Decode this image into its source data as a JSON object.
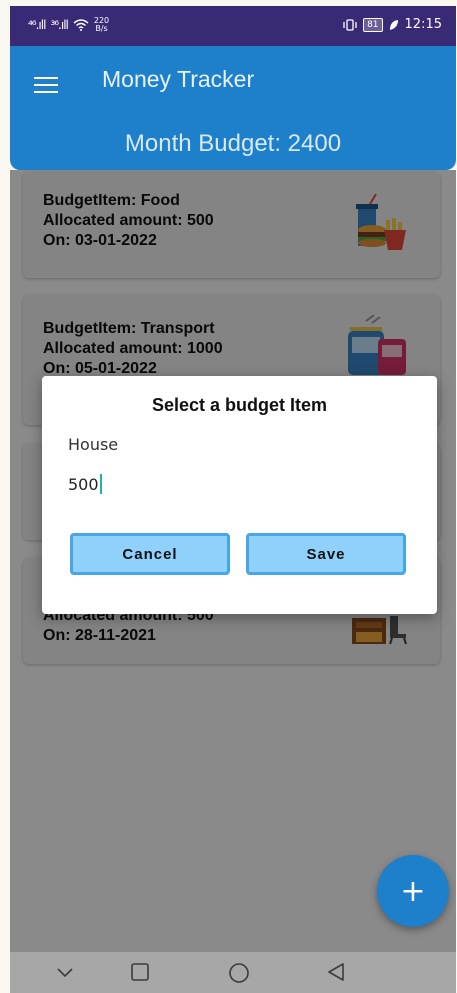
{
  "status_bar": {
    "signal1": "⁴⁶.ıll",
    "signal2": "³⁶.ıll",
    "speed_top": "220",
    "speed_bottom": "B/s",
    "battery": "81",
    "time": "12:15"
  },
  "app": {
    "title": "Money Tracker",
    "month_budget": "Month Budget: 2400"
  },
  "budget_items": [
    {
      "name": "BudgetItem: Food",
      "amount": "Allocated amount: 500",
      "date": "On: 03-01-2022",
      "icon": "food-icon"
    },
    {
      "name": "BudgetItem: Transport",
      "amount": "Allocated amount: 1000",
      "date": "On: 05-01-2022",
      "icon": "transport-icon"
    },
    {
      "name": "",
      "amount": "Allocated amount: 500",
      "date": "On: 28-11-2021",
      "icon": "house-icon"
    }
  ],
  "dialog": {
    "title": "Select a budget Item",
    "selected_item": "House",
    "amount_value": "500",
    "cancel_label": "Cancel",
    "save_label": "Save"
  },
  "fab": {
    "label": "+"
  },
  "colors": {
    "primary": "#1e7fcb",
    "status_bar": "#3a2a76",
    "button_fill": "#8fd1fb",
    "button_border": "#47a7e6"
  }
}
